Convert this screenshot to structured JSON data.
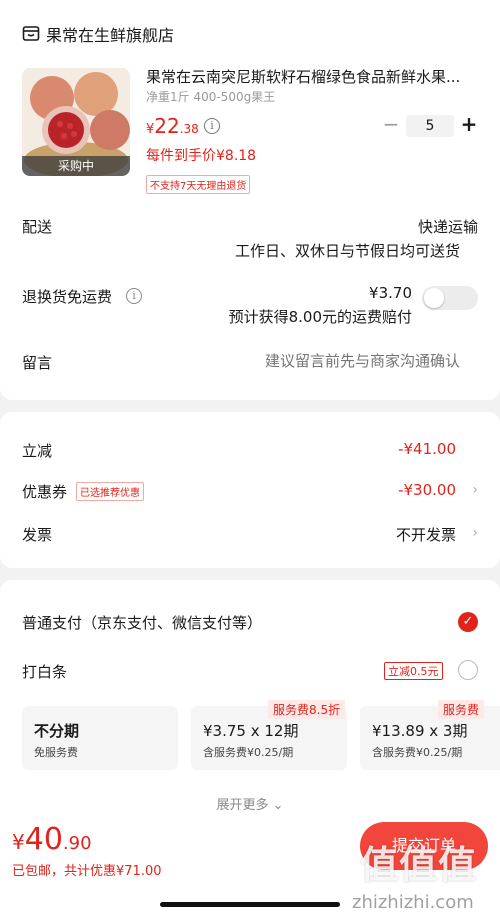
{
  "store": {
    "name": "果常在生鲜旗舰店",
    "icon": "store-icon"
  },
  "product": {
    "title": "果常在云南突尼斯软籽石榴绿色食品新鲜水果...",
    "spec": "净重1斤 400-500g果王",
    "price_symbol": "¥",
    "price_int": "22",
    "price_dec": ".38",
    "per_price": "每件到手价¥8.18",
    "no_return": "不支持7天无理由退货",
    "image_tag": "采购中",
    "quantity": "5",
    "qty_minus": "−",
    "qty_plus": "+"
  },
  "delivery": {
    "label": "配送",
    "method": "快递运输",
    "time": "工作日、双休日与节假日均可送货"
  },
  "return_shipping": {
    "label": "退换货免运费",
    "price": "¥3.70",
    "compensate": "预计获得8.00元的运费赔付",
    "enabled": false
  },
  "memo": {
    "label": "留言",
    "placeholder": "建议留言前先与商家沟通确认"
  },
  "discounts": {
    "instant_label": "立减",
    "instant_value": "-¥41.00",
    "coupon_label": "优惠券",
    "coupon_tag": "已选推荐优惠",
    "coupon_value": "-¥30.00",
    "invoice_label": "发票",
    "invoice_value": "不开发票"
  },
  "payment": {
    "normal_label": "普通支付（京东支付、微信支付等）",
    "normal_selected": true,
    "baitiao_label": "打白条",
    "baitiao_tag": "立减0.5元",
    "plans": [
      {
        "title": "不分期",
        "sub": "免服务费",
        "fee_tag": ""
      },
      {
        "title": "¥3.75 x 12期",
        "sub": "含服务费¥0.25/期",
        "fee_tag": "服务费8.5折"
      },
      {
        "title": "¥13.89 x 3期",
        "sub": "含服务费¥0.25/期",
        "fee_tag": "服务费"
      }
    ],
    "expand_more": "展开更多 ⌄"
  },
  "footer": {
    "total_symbol": "¥",
    "total_int": "40",
    "total_dec": ".90",
    "shipping_info": "已包邮，共计优惠¥71.00",
    "submit_label": "提交订单"
  },
  "watermark": {
    "text": "值值值",
    "url": "zhizhizhi.com"
  },
  "colors": {
    "accent": "#e2231a",
    "button": "#f2453b",
    "background": "#f2f2f2"
  }
}
